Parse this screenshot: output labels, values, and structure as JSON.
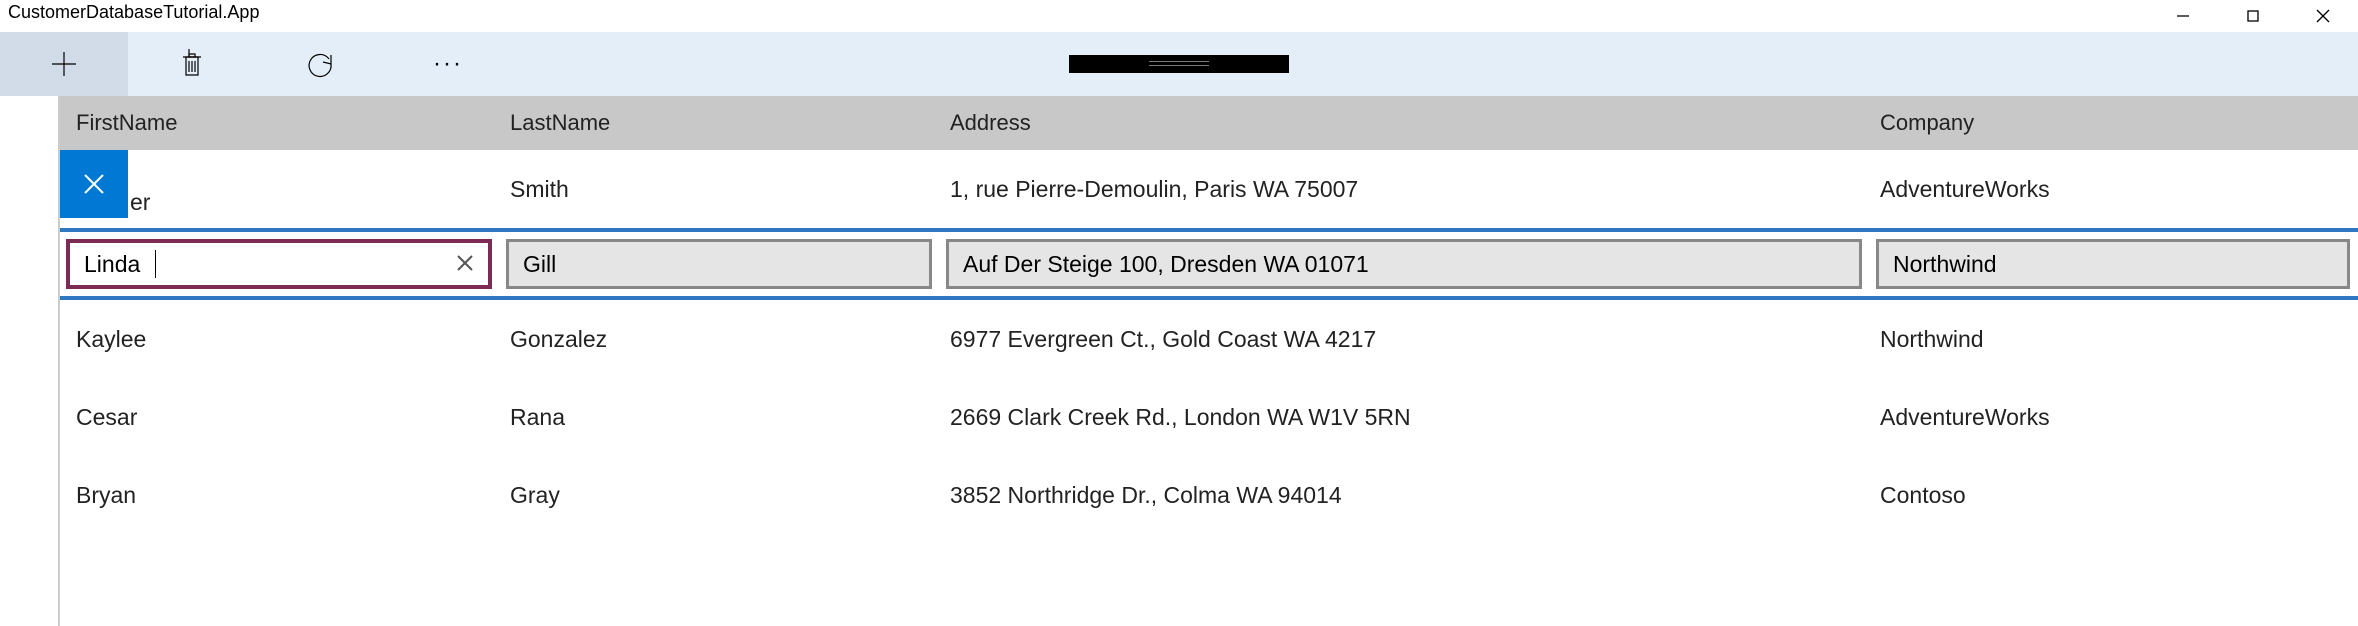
{
  "window": {
    "title": "CustomerDatabaseTutorial.App"
  },
  "toolbar": {
    "add": "Add",
    "delete": "Delete",
    "refresh": "Refresh",
    "more": "More"
  },
  "grid": {
    "headers": {
      "first": "FirstName",
      "last": "LastName",
      "address": "Address",
      "company": "Company"
    },
    "rows": [
      {
        "first_partial": "er",
        "last": "Smith",
        "address": "1, rue Pierre-Demoulin, Paris WA 75007",
        "company": "AdventureWorks"
      },
      {
        "first": "Linda",
        "last": "Gill",
        "address": "Auf Der Steige 100, Dresden WA 01071",
        "company": "Northwind"
      },
      {
        "first": "Kaylee",
        "last": "Gonzalez",
        "address": "6977 Evergreen Ct., Gold Coast WA 4217",
        "company": "Northwind"
      },
      {
        "first": "Cesar",
        "last": "Rana",
        "address": "2669 Clark Creek Rd., London WA W1V 5RN",
        "company": "AdventureWorks"
      },
      {
        "first": "Bryan",
        "last": "Gray",
        "address": "3852 Northridge Dr., Colma WA 94014",
        "company": "Contoso"
      }
    ]
  }
}
